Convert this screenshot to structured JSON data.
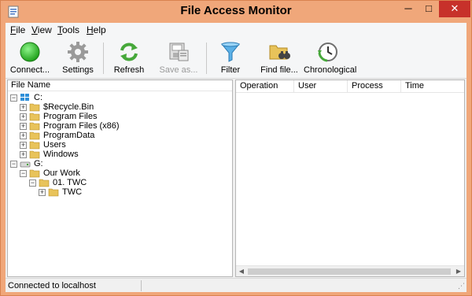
{
  "window": {
    "title": "File Access Monitor",
    "minimize": "─",
    "maximize": "□",
    "close": "✕"
  },
  "menu": [
    {
      "label": "File",
      "accel": "F",
      "rest": "ile"
    },
    {
      "label": "View",
      "accel": "V",
      "rest": "iew"
    },
    {
      "label": "Tools",
      "accel": "T",
      "rest": "ools"
    },
    {
      "label": "Help",
      "accel": "H",
      "rest": "elp"
    }
  ],
  "toolbar": {
    "connect": "Connect...",
    "settings": "Settings",
    "refresh": "Refresh",
    "save_as": "Save as...",
    "filter": "Filter",
    "find_file": "Find file...",
    "chronological": "Chronological"
  },
  "tree": {
    "header": "File Name",
    "items": [
      {
        "label": "C:",
        "expander": "−",
        "icon": "drive-icon"
      },
      {
        "label": "$Recycle.Bin",
        "expander": "+",
        "icon": "folder-icon"
      },
      {
        "label": "Program Files",
        "expander": "+",
        "icon": "folder-icon"
      },
      {
        "label": "Program Files (x86)",
        "expander": "+",
        "icon": "folder-icon"
      },
      {
        "label": "ProgramData",
        "expander": "+",
        "icon": "folder-icon"
      },
      {
        "label": "Users",
        "expander": "+",
        "icon": "folder-icon"
      },
      {
        "label": "Windows",
        "expander": "+",
        "icon": "folder-icon"
      },
      {
        "label": "G:",
        "expander": "−",
        "icon": "drive-icon"
      },
      {
        "label": "Our Work",
        "expander": "−",
        "icon": "folder-icon"
      },
      {
        "label": "01. TWC",
        "expander": "−",
        "icon": "folder-icon"
      },
      {
        "label": "TWC",
        "expander": "+",
        "icon": "folder-icon"
      }
    ]
  },
  "list": {
    "columns": [
      "Operation",
      "User",
      "Process",
      "Time"
    ]
  },
  "status": {
    "text": "Connected to localhost"
  },
  "colors": {
    "title_bar": "#f0a77a",
    "close_button": "#c7312a",
    "folder": "#e8c35a"
  }
}
